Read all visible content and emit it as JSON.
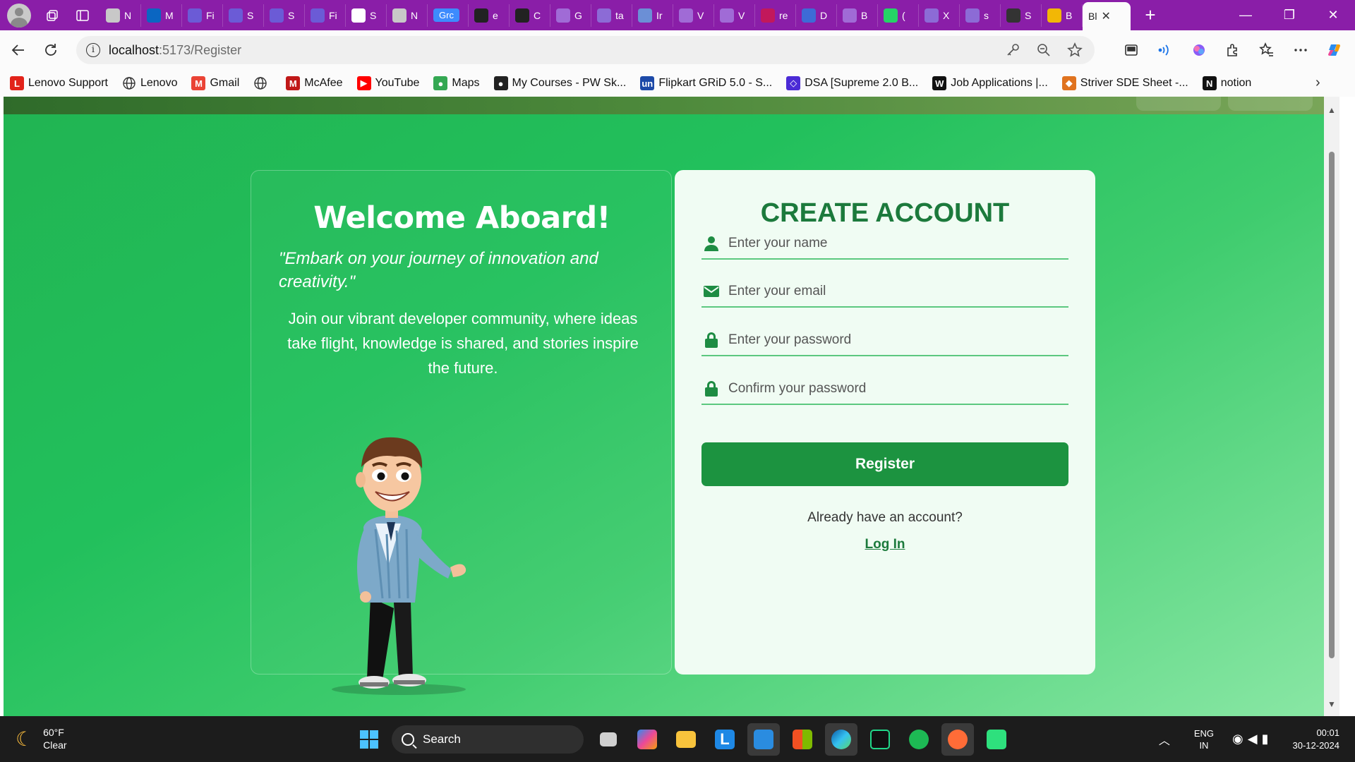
{
  "browser": {
    "tabs": [
      {
        "label": "N",
        "color": "#c8c8c8"
      },
      {
        "label": "M",
        "color": "#0a66c2"
      },
      {
        "label": "Fi",
        "color": "#6b5bd6"
      },
      {
        "label": "S",
        "color": "#6b5bd6"
      },
      {
        "label": "S",
        "color": "#6b5bd6"
      },
      {
        "label": "Fi",
        "color": "#6b5bd6"
      },
      {
        "label": "S",
        "color": "#ffffff"
      },
      {
        "label": "N",
        "color": "#c8c8c8"
      },
      {
        "label": "Grc",
        "color": "#3d8bfd"
      },
      {
        "label": "e",
        "color": "#222222"
      },
      {
        "label": "C",
        "color": "#222222"
      },
      {
        "label": "G",
        "color": "#a06bd6"
      },
      {
        "label": "ta",
        "color": "#8c6bd6"
      },
      {
        "label": "Ir",
        "color": "#6b8fd6"
      },
      {
        "label": "V",
        "color": "#a06bd6"
      },
      {
        "label": "V",
        "color": "#a06bd6"
      },
      {
        "label": "re",
        "color": "#c2185b"
      },
      {
        "label": "D",
        "color": "#3d6bd6"
      },
      {
        "label": "B",
        "color": "#a06bd6"
      },
      {
        "label": "(",
        "color": "#25d366"
      },
      {
        "label": "X",
        "color": "#8c6bd6"
      },
      {
        "label": "s",
        "color": "#8c6bd6"
      },
      {
        "label": "S",
        "color": "#333333"
      },
      {
        "label": "B",
        "color": "#f2b705"
      }
    ],
    "active_tab_label": "Bl",
    "url_host": "localhost",
    "url_path": ":5173/Register",
    "bookmarks": [
      {
        "label": "Lenovo Support",
        "icon": "L",
        "color": "#e2231a"
      },
      {
        "label": "Lenovo",
        "icon": "globe",
        "color": "#333333"
      },
      {
        "label": "Gmail",
        "icon": "M",
        "color": "#ea4335"
      },
      {
        "label": "",
        "icon": "globe",
        "color": "#333333"
      },
      {
        "label": "McAfee",
        "icon": "M",
        "color": "#c01818"
      },
      {
        "label": "YouTube",
        "icon": "▶",
        "color": "#ff0000"
      },
      {
        "label": "Maps",
        "icon": "●",
        "color": "#34a853"
      },
      {
        "label": "My Courses - PW Sk...",
        "icon": "●",
        "color": "#222222"
      },
      {
        "label": "Flipkart GRiD 5.0 - S...",
        "icon": "un",
        "color": "#1d4aa8"
      },
      {
        "label": "DSA [Supreme 2.0 B...",
        "icon": "◇",
        "color": "#4b2bd6"
      },
      {
        "label": "Job Applications |...",
        "icon": "W",
        "color": "#111111"
      },
      {
        "label": "Striver SDE Sheet -...",
        "icon": "◆",
        "color": "#e0731f"
      },
      {
        "label": "notion",
        "icon": "N",
        "color": "#111111"
      }
    ]
  },
  "page": {
    "welcome_title": "Welcome Aboard!",
    "quote": "\"Embark on your journey of innovation and creativity.\"",
    "description": "Join our vibrant developer community, where ideas take flight, knowledge is shared, and stories inspire the future.",
    "form_title": "CREATE ACCOUNT",
    "fields": {
      "name_placeholder": "Enter your name",
      "email_placeholder": "Enter your email",
      "password_placeholder": "Enter your password",
      "confirm_placeholder": "Confirm your password"
    },
    "register_label": "Register",
    "already_text": "Already have an account?",
    "login_label": "Log In"
  },
  "taskbar": {
    "temperature": "60°F",
    "weather": "Clear",
    "search_label": "Search",
    "lang_line1": "ENG",
    "lang_line2": "IN",
    "time": "00:01",
    "date": "30-12-2024"
  },
  "colors": {
    "accent": "#1c9340",
    "title_green": "#1c7a3c",
    "tabstrip": "#8a1ea8"
  }
}
